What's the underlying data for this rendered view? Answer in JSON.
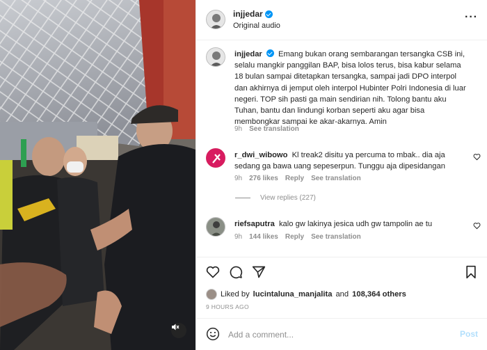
{
  "header": {
    "username": "injjedar",
    "subtitle": "Original audio",
    "more_icon": "more-horizontal-icon"
  },
  "caption": {
    "username": "injjedar",
    "text": "Emang bukan orang sembarangan tersangka CSB ini, selalu mangkir panggilan BAP, bisa lolos terus, bisa kabur selama 18 bulan sampai ditetapkan tersangka, sampai jadi DPO interpol dan akhirnya di jemput oleh interpol Hubinter Polri Indonesia di luar negeri. TOP sih pasti ga main sendirian nih. Tolong bantu aku Tuhan, bantu dan lindungi korban seperti aku agar bisa membongkar sampai ke akar-akarnya. Amin",
    "age": "9h",
    "see_translation": "See translation"
  },
  "comments": [
    {
      "username": "r_dwi_wibowo",
      "text": "Kl treak2 disitu ya percuma to mbak.. dia aja sedang ga bawa uang sepeserpun. Tunggu aja dipesidangan",
      "age": "9h",
      "likes": "276 likes",
      "reply": "Reply",
      "see_translation": "See translation"
    },
    {
      "username": "riefsaputra",
      "text": "kalo gw lakinya jesica udh gw tampolin ae tu",
      "age": "9h",
      "likes": "144 likes",
      "reply": "Reply",
      "see_translation": "See translation"
    }
  ],
  "view_replies": "View replies (227)",
  "likes": {
    "prefix": "Liked by",
    "user": "lucintaluna_manjalita",
    "middle": "and",
    "others": "108,364 others"
  },
  "timestamp": "9 HOURS AGO",
  "add_comment": {
    "placeholder": "Add a comment...",
    "post_label": "Post"
  },
  "colors": {
    "verified": "#0095f6",
    "muted_text": "#8e8e8e",
    "post_disabled": "#b2dffc"
  }
}
